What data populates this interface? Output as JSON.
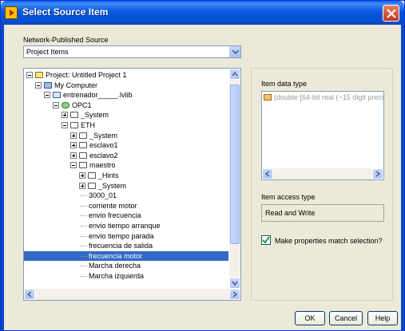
{
  "window": {
    "title": "Select Source Item"
  },
  "source": {
    "label": "Network-Published Source",
    "selected": "Project Items"
  },
  "tree": [
    {
      "label": "Project: Untitled Project 1",
      "depth": 0,
      "expander": "minus",
      "icon": "project-icon"
    },
    {
      "label": "My Computer",
      "depth": 1,
      "expander": "minus",
      "icon": "computer-icon"
    },
    {
      "label": "entrenador_____.lvlib",
      "depth": 2,
      "expander": "minus",
      "icon": "library-icon"
    },
    {
      "label": "OPC1",
      "depth": 3,
      "expander": "minus",
      "icon": "io-server-icon"
    },
    {
      "label": "_System",
      "depth": 4,
      "expander": "plus",
      "icon": "folder-icon"
    },
    {
      "label": "ETH",
      "depth": 4,
      "expander": "minus",
      "icon": "folder-icon"
    },
    {
      "label": "_System",
      "depth": 5,
      "expander": "plus",
      "icon": "folder-icon"
    },
    {
      "label": "esclavo1",
      "depth": 5,
      "expander": "plus",
      "icon": "folder-icon"
    },
    {
      "label": "esclavo2",
      "depth": 5,
      "expander": "plus",
      "icon": "folder-icon"
    },
    {
      "label": "maestro",
      "depth": 5,
      "expander": "minus",
      "icon": "folder-icon"
    },
    {
      "label": "_Hints",
      "depth": 6,
      "expander": "plus",
      "icon": "folder-icon"
    },
    {
      "label": "_System",
      "depth": 6,
      "expander": "plus",
      "icon": "folder-icon"
    },
    {
      "label": "3000_01",
      "depth": 6,
      "expander": "none",
      "icon": ""
    },
    {
      "label": "corriente motor",
      "depth": 6,
      "expander": "none",
      "icon": ""
    },
    {
      "label": "envio frecuencia",
      "depth": 6,
      "expander": "none",
      "icon": ""
    },
    {
      "label": "envio tiempo arranque",
      "depth": 6,
      "expander": "none",
      "icon": ""
    },
    {
      "label": "envio tiempo parada",
      "depth": 6,
      "expander": "none",
      "icon": ""
    },
    {
      "label": "frecuencia de salida",
      "depth": 6,
      "expander": "none",
      "icon": ""
    },
    {
      "label": "frecuencia motor",
      "depth": 6,
      "expander": "none",
      "icon": "",
      "selected": true
    },
    {
      "label": "Marcha derecha",
      "depth": 6,
      "expander": "none",
      "icon": ""
    },
    {
      "label": "Marcha izquierda",
      "depth": 6,
      "expander": "none",
      "icon": ""
    }
  ],
  "item_data_type": {
    "label": "Item data type",
    "value": "(double [64-bit real (~15 digit preci"
  },
  "item_access_type": {
    "label": "Item access type",
    "value": "Read and Write"
  },
  "match_selection": {
    "label": "Make properties match selection?",
    "checked": true
  },
  "buttons": {
    "ok": "OK",
    "cancel": "Cancel",
    "help": "Help"
  },
  "colors": {
    "selection": "#316ac5",
    "titlebar": "#0a58df",
    "dialog_bg": "#ece9d8"
  }
}
